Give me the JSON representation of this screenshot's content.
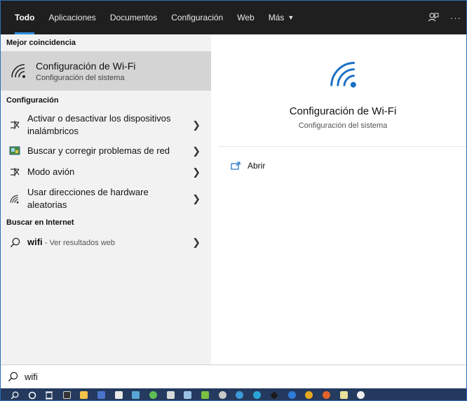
{
  "tabs": [
    {
      "label": "Todo",
      "active": true
    },
    {
      "label": "Aplicaciones"
    },
    {
      "label": "Documentos"
    },
    {
      "label": "Configuración"
    },
    {
      "label": "Web"
    },
    {
      "label": "Más",
      "has_caret": true
    }
  ],
  "top_icons": [
    "feedback-icon",
    "more-options-icon"
  ],
  "best_match": {
    "heading": "Mejor coincidencia",
    "title": "Configuración de Wi-Fi",
    "subtitle": "Configuración del sistema",
    "icon": "wifi-icon"
  },
  "settings": {
    "heading": "Configuración",
    "items": [
      {
        "label": "Activar o desactivar los dispositivos inalámbricos",
        "icon": "wireless-devices-icon"
      },
      {
        "label": "Buscar y corregir problemas de red",
        "icon": "network-troubleshoot-icon"
      },
      {
        "label": "Modo avión",
        "icon": "airplane-mode-icon"
      },
      {
        "label": "Usar direcciones de hardware aleatorias",
        "icon": "wifi-icon"
      }
    ]
  },
  "internet": {
    "heading": "Buscar en Internet",
    "query": "wifi",
    "suffix": " - Ver resultados web"
  },
  "preview": {
    "title": "Configuración de Wi-Fi",
    "subtitle": "Configuración del sistema",
    "action_label": "Abrir"
  },
  "search": {
    "value": "wifi"
  },
  "colors": {
    "accent": "#2f8ee0",
    "wifi_blue": "#1a6fc4",
    "topbar": "#1f1f1f",
    "left_panel": "#f2f2f2",
    "selected": "#d4d4d4",
    "taskbar": "#243a5e"
  },
  "taskbar_icons": [
    "search-icon",
    "cortana-icon",
    "task-view-icon",
    "terminal-icon",
    "file-explorer-icon",
    "floppy-icon",
    "qr-app-icon",
    "display-icon",
    "shield-app-icon",
    "paint-app-icon",
    "cube-app-icon",
    "plant-app-icon",
    "cloud-app-icon",
    "edge-icon",
    "teams-icon",
    "diamond-app-icon",
    "fish-app-icon",
    "chrome-icon",
    "firefox-icon",
    "notepad-icon",
    "photos-icon"
  ]
}
